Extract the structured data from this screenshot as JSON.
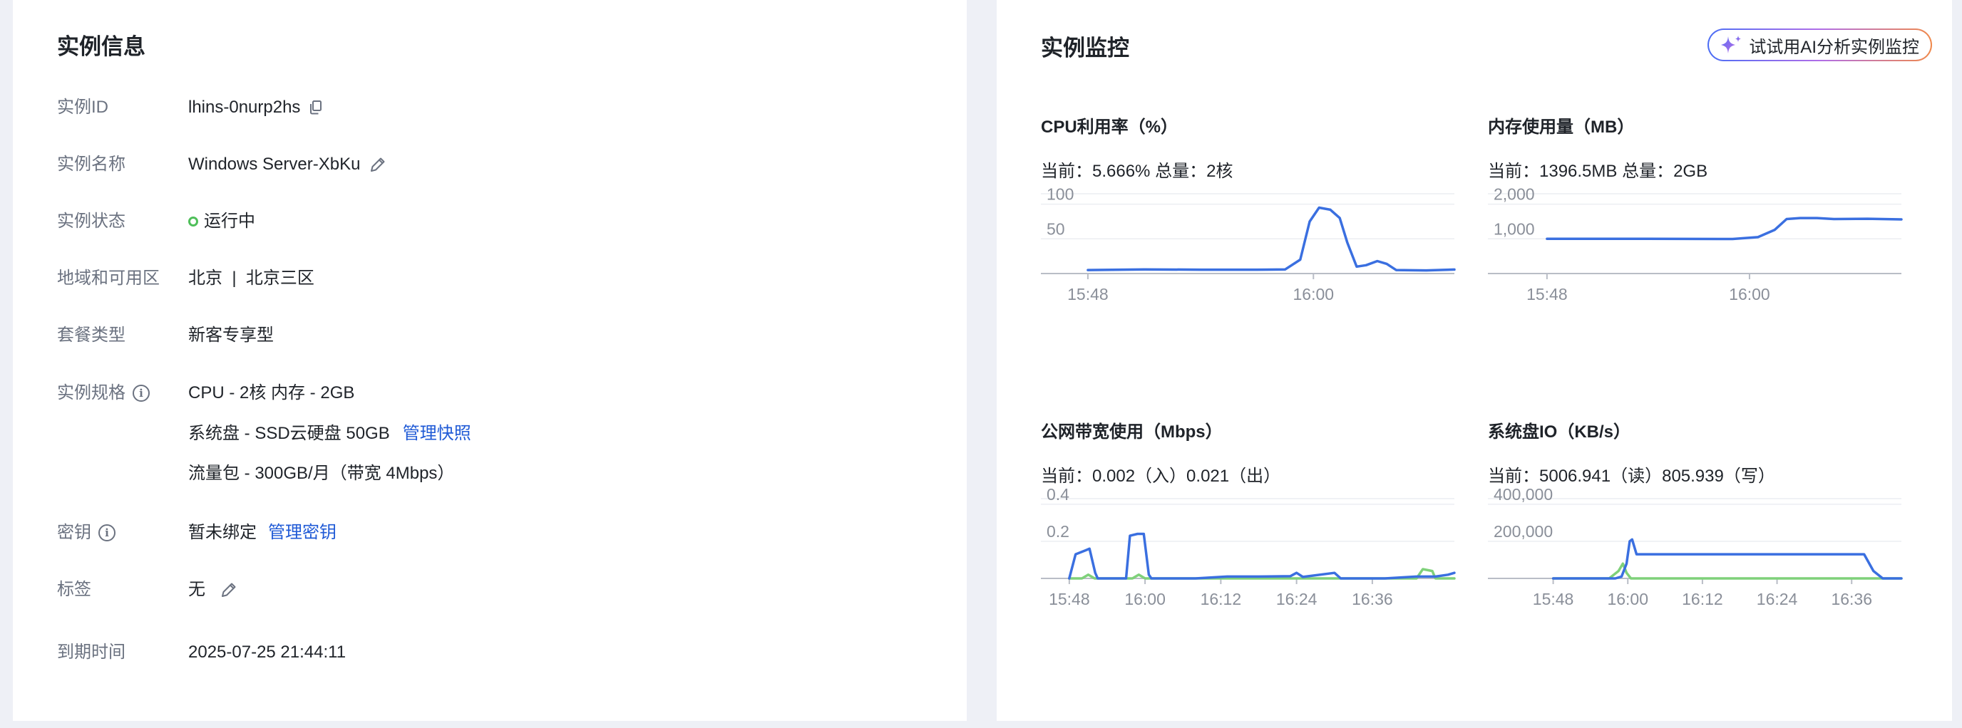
{
  "left": {
    "title": "实例信息",
    "rows": {
      "id": {
        "label": "实例ID",
        "value": "lhins-0nurp2hs"
      },
      "name": {
        "label": "实例名称",
        "value": "Windows Server-XbKu"
      },
      "status": {
        "label": "实例状态",
        "value": "运行中"
      },
      "region": {
        "label": "地域和可用区",
        "value": "北京  |  北京三区"
      },
      "package": {
        "label": "套餐类型",
        "value": "新客专享型"
      },
      "spec": {
        "label": "实例规格",
        "line1": "CPU - 2核 内存 - 2GB",
        "line2": "系统盘 - SSD云硬盘 50GB",
        "line2_link": "管理快照",
        "line3": "流量包 - 300GB/月（带宽 4Mbps）"
      },
      "key": {
        "label": "密钥",
        "value": "暂未绑定",
        "link": "管理密钥"
      },
      "tags": {
        "label": "标签",
        "value": "无"
      },
      "expiry": {
        "label": "到期时间",
        "value": "2025-07-25 21:44:11"
      }
    }
  },
  "right": {
    "title": "实例监控",
    "ai_button": "试试用AI分析实例监控",
    "accent_color": "#3a6fe0",
    "secondary_color": "#7fd17a",
    "charts": {
      "cpu": {
        "title": "CPU利用率（%）",
        "current": "当前：5.666% 总量：2核"
      },
      "mem": {
        "title": "内存使用量（MB）",
        "current": "当前：1396.5MB 总量：2GB"
      },
      "net": {
        "title": "公网带宽使用（Mbps）",
        "current": "当前：0.002（入）0.021（出）"
      },
      "io": {
        "title": "系统盘IO（KB/s）",
        "current": "当前：5006.941（读）805.939（写）"
      }
    }
  },
  "chart_data": [
    {
      "id": "cpu",
      "type": "line",
      "title": "CPU利用率（%）",
      "x_unit": "minutes",
      "x_ticks": [
        [
          0,
          "15:48"
        ],
        [
          12,
          "16:00"
        ]
      ],
      "xlim": [
        -2.5,
        19.5
      ],
      "y_ticks": [
        [
          50,
          "50"
        ],
        [
          100,
          "100"
        ]
      ],
      "ylim": [
        0,
        115
      ],
      "series": [
        {
          "color": "#3a6fe0",
          "points": [
            [
              0,
              5
            ],
            [
              3,
              6
            ],
            [
              6,
              5.5
            ],
            [
              9,
              5.5
            ],
            [
              10.5,
              6
            ],
            [
              11.3,
              20
            ],
            [
              11.8,
              75
            ],
            [
              12.3,
              95
            ],
            [
              12.9,
              92
            ],
            [
              13.4,
              80
            ],
            [
              13.8,
              45
            ],
            [
              14.3,
              10
            ],
            [
              14.8,
              12
            ],
            [
              15.4,
              18
            ],
            [
              15.9,
              14
            ],
            [
              16.4,
              5
            ],
            [
              18,
              4.5
            ],
            [
              19.5,
              5.7
            ]
          ]
        }
      ]
    },
    {
      "id": "mem",
      "type": "line",
      "title": "内存使用量（MB）",
      "x_unit": "minutes",
      "x_ticks": [
        [
          0,
          "15:48"
        ],
        [
          12,
          "16:00"
        ]
      ],
      "xlim": [
        -3.5,
        21
      ],
      "y_ticks": [
        [
          1000,
          "1,000"
        ],
        [
          2000,
          "2,000"
        ]
      ],
      "ylim": [
        0,
        2300
      ],
      "series": [
        {
          "color": "#3a6fe0",
          "points": [
            [
              0,
              1000
            ],
            [
              6,
              1000
            ],
            [
              11,
              995
            ],
            [
              12.5,
              1050
            ],
            [
              13.5,
              1260
            ],
            [
              14.2,
              1570
            ],
            [
              15,
              1600
            ],
            [
              16,
              1600
            ],
            [
              17,
              1570
            ],
            [
              19,
              1580
            ],
            [
              21,
              1560
            ]
          ]
        }
      ]
    },
    {
      "id": "net",
      "type": "line",
      "title": "公网带宽使用（Mbps）",
      "x_unit": "minutes",
      "x_ticks": [
        [
          0,
          "15:48"
        ],
        [
          12,
          "16:00"
        ],
        [
          24,
          "16:12"
        ],
        [
          36,
          "16:24"
        ],
        [
          48,
          "16:36"
        ]
      ],
      "xlim": [
        -4.5,
        61
      ],
      "y_ticks": [
        [
          0.2,
          "0.2"
        ],
        [
          0.4,
          "0.4"
        ]
      ],
      "ylim": [
        0,
        0.43
      ],
      "series": [
        {
          "color": "#3a6fe0",
          "points": [
            [
              0,
              0
            ],
            [
              1,
              0.13
            ],
            [
              2.5,
              0.15
            ],
            [
              3.2,
              0.16
            ],
            [
              4.1,
              0.03
            ],
            [
              4.5,
              0
            ],
            [
              9,
              0
            ],
            [
              9.6,
              0.23
            ],
            [
              10.8,
              0.24
            ],
            [
              11.8,
              0.24
            ],
            [
              12.6,
              0.02
            ],
            [
              13,
              0
            ],
            [
              20,
              0
            ],
            [
              25,
              0.01
            ],
            [
              30,
              0.01
            ],
            [
              35,
              0.012
            ],
            [
              36,
              0.03
            ],
            [
              37,
              0.008
            ],
            [
              42,
              0.03
            ],
            [
              43,
              0
            ],
            [
              50,
              0
            ],
            [
              55,
              0.01
            ],
            [
              58,
              0.01
            ],
            [
              60,
              0.02
            ],
            [
              61,
              0.03
            ]
          ]
        },
        {
          "color": "#7fd17a",
          "points": [
            [
              0,
              0
            ],
            [
              2,
              0
            ],
            [
              3,
              0.02
            ],
            [
              4,
              0
            ],
            [
              10,
              0
            ],
            [
              11,
              0.02
            ],
            [
              12,
              0
            ],
            [
              55,
              0
            ],
            [
              56,
              0.05
            ],
            [
              57.5,
              0.04
            ],
            [
              58,
              0
            ],
            [
              61,
              0
            ]
          ]
        }
      ]
    },
    {
      "id": "io",
      "type": "line",
      "title": "系统盘IO（KB/s）",
      "x_unit": "minutes",
      "x_ticks": [
        [
          0,
          "15:48"
        ],
        [
          12,
          "16:00"
        ],
        [
          24,
          "16:12"
        ],
        [
          36,
          "16:24"
        ],
        [
          48,
          "16:36"
        ]
      ],
      "xlim": [
        -10.5,
        56
      ],
      "y_ticks": [
        [
          200000,
          "200,000"
        ],
        [
          400000,
          "400,000"
        ]
      ],
      "ylim": [
        0,
        430000
      ],
      "series": [
        {
          "color": "#3a6fe0",
          "points": [
            [
              0,
              0
            ],
            [
              10,
              0
            ],
            [
              11,
              10000
            ],
            [
              11.8,
              80000
            ],
            [
              12.3,
              200000
            ],
            [
              12.7,
              210000
            ],
            [
              13.4,
              130000
            ],
            [
              20,
              130000
            ],
            [
              30,
              130000
            ],
            [
              40,
              130000
            ],
            [
              50,
              130000
            ],
            [
              51.5,
              40000
            ],
            [
              53,
              0
            ],
            [
              56,
              0
            ]
          ]
        },
        {
          "color": "#7fd17a",
          "points": [
            [
              0,
              0
            ],
            [
              9,
              0
            ],
            [
              10.5,
              40000
            ],
            [
              11.2,
              80000
            ],
            [
              11.8,
              30000
            ],
            [
              12.5,
              0
            ],
            [
              56,
              0
            ]
          ]
        }
      ]
    }
  ]
}
